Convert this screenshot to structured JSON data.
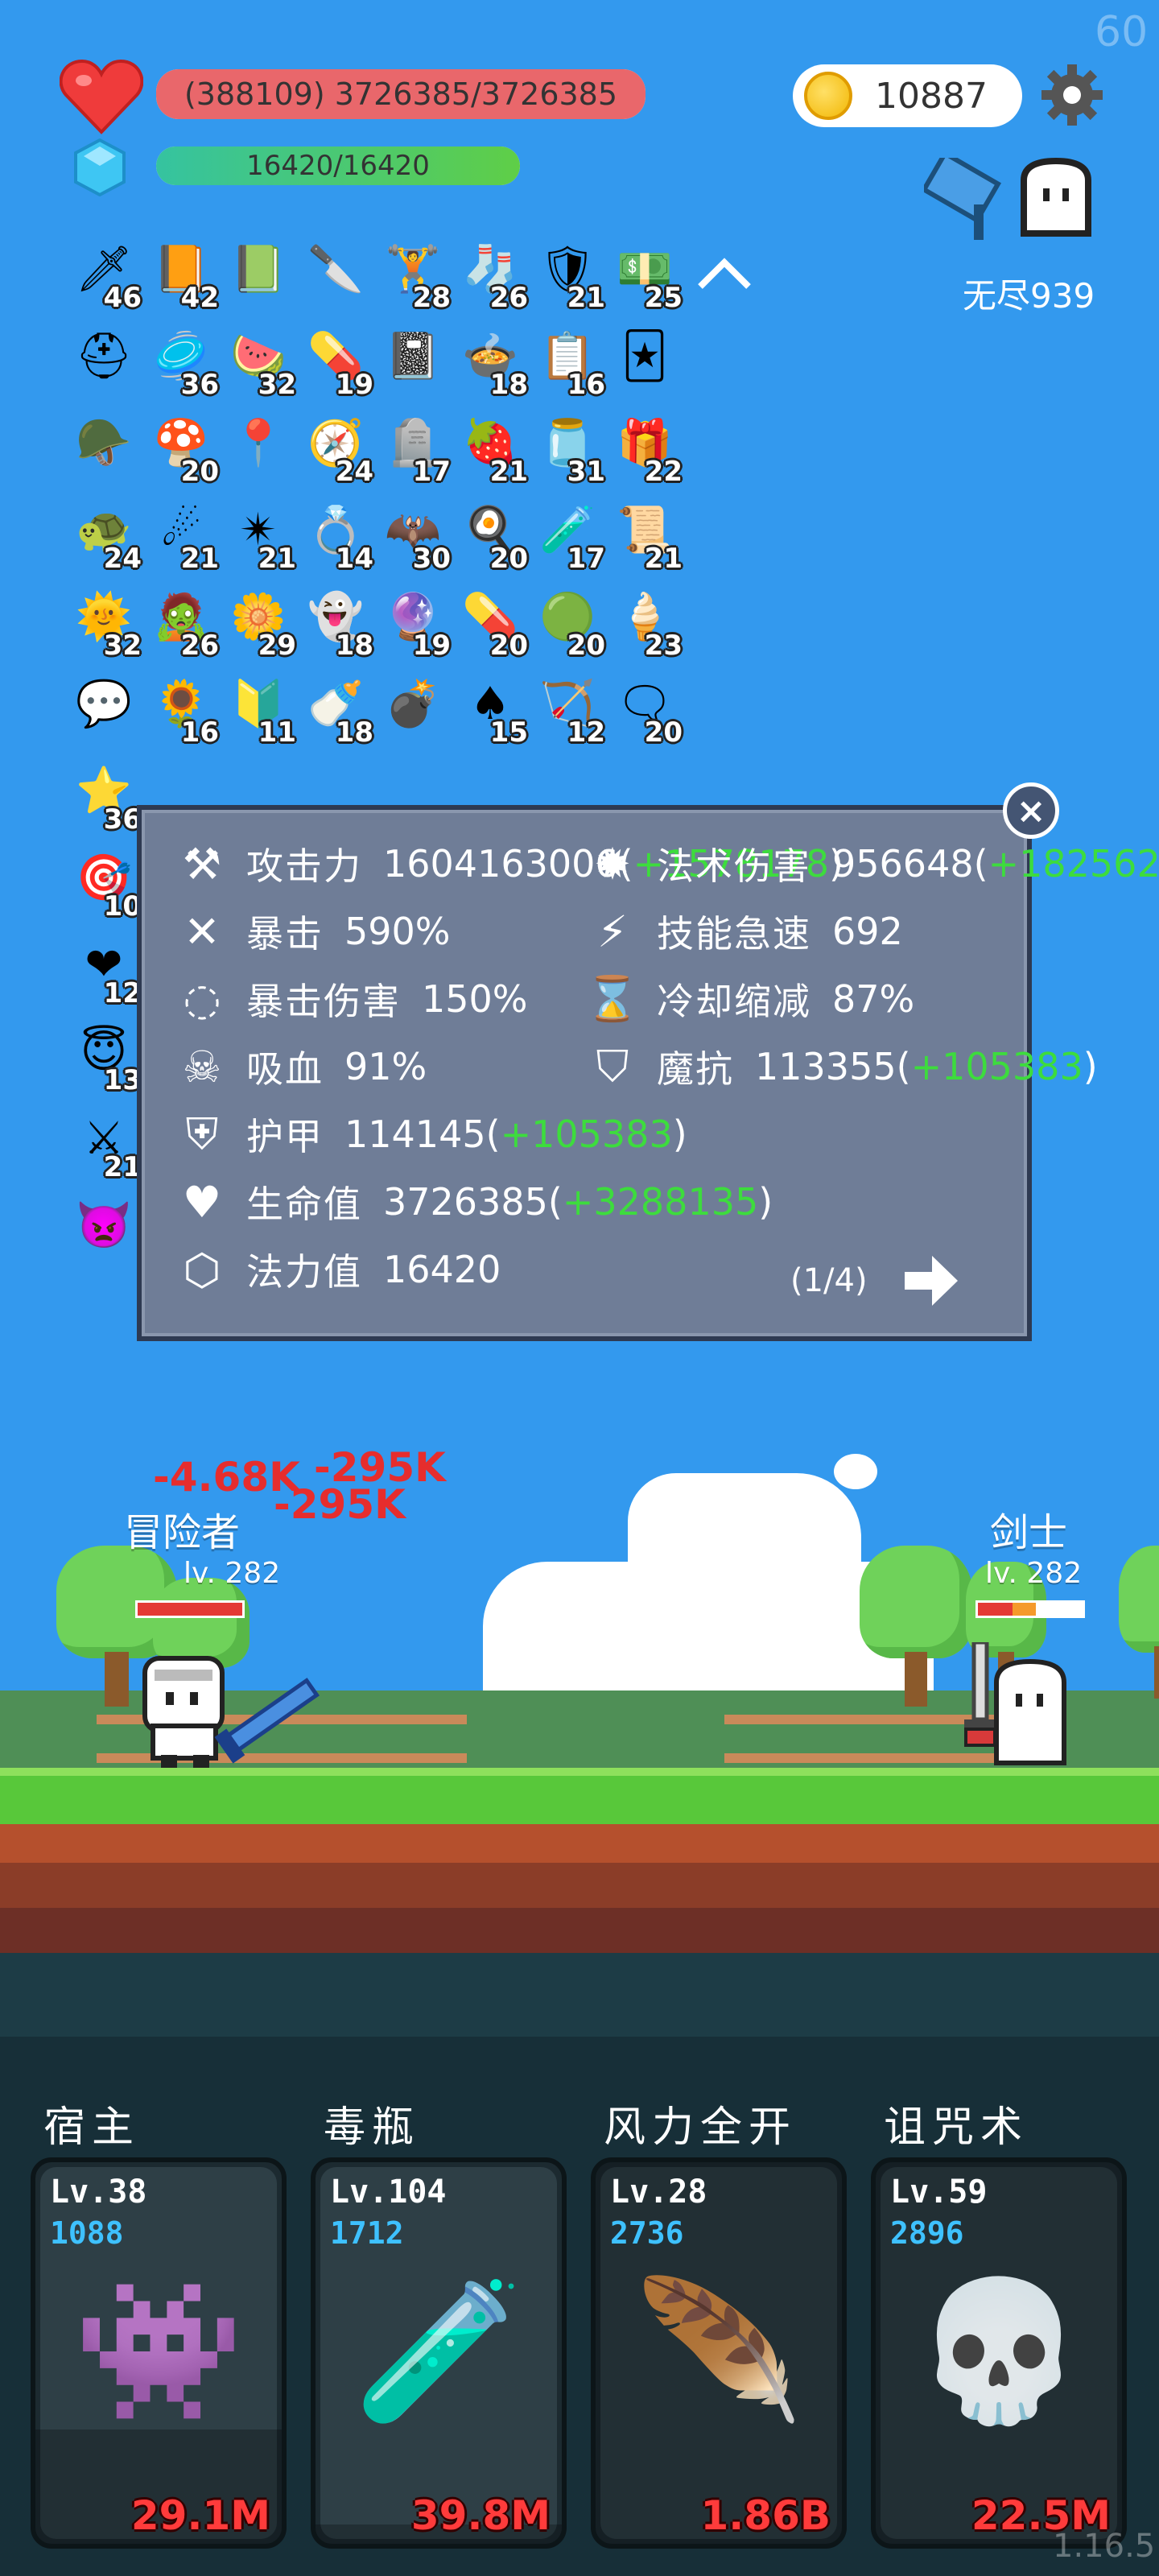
{
  "fps": "60",
  "version": "1.16.5",
  "hud": {
    "hp_text": "(388109) 3726385/3726385",
    "hp_fraction": 1.0,
    "mp_text": "16420/16420",
    "mp_fraction": 1.0,
    "coins": "10887",
    "mode_label": "无尽939"
  },
  "inventory": [
    {
      "icon": "sword-icon",
      "glyph": "🗡",
      "count": "46"
    },
    {
      "icon": "book-icon",
      "glyph": "📙",
      "count": "42"
    },
    {
      "icon": "note-icon",
      "glyph": "📗",
      "count": ""
    },
    {
      "icon": "blade-icon",
      "glyph": "🔪",
      "count": ""
    },
    {
      "icon": "dumbbell-icon",
      "glyph": "🏋",
      "count": "28"
    },
    {
      "icon": "sock-icon",
      "glyph": "🧦",
      "count": "26"
    },
    {
      "icon": "shield-icon",
      "glyph": "🛡",
      "count": "21"
    },
    {
      "icon": "money-heart-icon",
      "glyph": "💵",
      "count": "25"
    },
    {
      "icon": "helmet-icon",
      "glyph": "⛑",
      "count": ""
    },
    {
      "icon": "round-shield-icon",
      "glyph": "🥏",
      "count": "36"
    },
    {
      "icon": "watermelon-icon",
      "glyph": "🍉",
      "count": "32"
    },
    {
      "icon": "pill-icon",
      "glyph": "💊",
      "count": "19"
    },
    {
      "icon": "skull-book-icon",
      "glyph": "📓",
      "count": ""
    },
    {
      "icon": "cauldron-icon",
      "glyph": "🍲",
      "count": "18"
    },
    {
      "icon": "clipboard-icon",
      "glyph": "📋",
      "count": "16"
    },
    {
      "icon": "cards-icon",
      "glyph": "🃏",
      "count": ""
    },
    {
      "icon": "knight-helmet-icon",
      "glyph": "🪖",
      "count": ""
    },
    {
      "icon": "mushroom-icon",
      "glyph": "🍄",
      "count": "20"
    },
    {
      "icon": "map-pin-icon",
      "glyph": "📍",
      "count": ""
    },
    {
      "icon": "compass-icon",
      "glyph": "🧭",
      "count": "24"
    },
    {
      "icon": "tombstone-icon",
      "glyph": "🪦",
      "count": "17"
    },
    {
      "icon": "strawberry-icon",
      "glyph": "🍓",
      "count": "21"
    },
    {
      "icon": "jam-jar-icon",
      "glyph": "🫙",
      "count": "31"
    },
    {
      "icon": "purple-box-icon",
      "glyph": "🎁",
      "count": "22"
    },
    {
      "icon": "turtle-shell-icon",
      "glyph": "🐢",
      "count": "24"
    },
    {
      "icon": "meteor-icon",
      "glyph": "☄",
      "count": "21"
    },
    {
      "icon": "spike-ball-icon",
      "glyph": "✴",
      "count": "21"
    },
    {
      "icon": "ring-icon",
      "glyph": "💍",
      "count": "14"
    },
    {
      "icon": "bat-icon",
      "glyph": "🦇",
      "count": "30"
    },
    {
      "icon": "egg-icon",
      "glyph": "🍳",
      "count": "20"
    },
    {
      "icon": "potion-flask-icon",
      "glyph": "🧪",
      "count": "17"
    },
    {
      "icon": "scroll-icon",
      "glyph": "📜",
      "count": "21"
    },
    {
      "icon": "sun-icon",
      "glyph": "🌞",
      "count": "32"
    },
    {
      "icon": "zombie-icon",
      "glyph": "🧟",
      "count": "26"
    },
    {
      "icon": "flower-icon",
      "glyph": "🌼",
      "count": "29"
    },
    {
      "icon": "ghost-icon",
      "glyph": "👻",
      "count": "18"
    },
    {
      "icon": "crystal-ball-icon",
      "glyph": "🔮",
      "count": "19"
    },
    {
      "icon": "red-pill-icon",
      "glyph": "💊",
      "count": "20"
    },
    {
      "icon": "slime-icon",
      "glyph": "🟢",
      "count": "20"
    },
    {
      "icon": "ice-cream-icon",
      "glyph": "🍦",
      "count": "23"
    },
    {
      "icon": "chat-bubble-icon",
      "glyph": "💬",
      "count": ""
    },
    {
      "icon": "sunflower-icon",
      "glyph": "🌻",
      "count": "16"
    },
    {
      "icon": "star-shield-icon",
      "glyph": "🔰",
      "count": "11"
    },
    {
      "icon": "milk-bottle-icon",
      "glyph": "🍼",
      "count": "18"
    },
    {
      "icon": "grenade-icon",
      "glyph": "💣",
      "count": ""
    },
    {
      "icon": "playing-card-icon",
      "glyph": "♠",
      "count": "15"
    },
    {
      "icon": "crossbow-icon",
      "glyph": "🏹",
      "count": "12"
    },
    {
      "icon": "speech-icon",
      "glyph": "🗨",
      "count": "20"
    },
    {
      "icon": "star-card-icon",
      "glyph": "⭐",
      "count": "36"
    },
    {
      "icon": "target-icon",
      "glyph": "🎯",
      "count": "10"
    },
    {
      "icon": "heart-item-icon",
      "glyph": "❤",
      "count": "12"
    },
    {
      "icon": "angel-wings-icon",
      "glyph": "😇",
      "count": "13"
    },
    {
      "icon": "pixel-sword-icon",
      "glyph": "⚔",
      "count": "21"
    },
    {
      "icon": "demon-face-icon",
      "glyph": "👿",
      "count": ""
    }
  ],
  "stats_panel": {
    "page": "(1/4)",
    "rows": [
      {
        "icon": "axe-icon",
        "glyph": "⚒",
        "label": "攻击力",
        "value": "1604163006",
        "bonus": "+1578178"
      },
      {
        "icon": "magic-sun-icon",
        "glyph": "✹",
        "label": "法术伤害",
        "value": "956648",
        "bonus": "+182562"
      },
      {
        "icon": "crit-icon",
        "glyph": "✕",
        "label": "暴击",
        "value": "590%",
        "bonus": ""
      },
      {
        "icon": "lightning-icon",
        "glyph": "⚡",
        "label": "技能急速",
        "value": "692",
        "bonus": ""
      },
      {
        "icon": "crit-damage-icon",
        "glyph": "◌",
        "label": "暴击伤害",
        "value": "150%",
        "bonus": ""
      },
      {
        "icon": "hourglass-icon",
        "glyph": "⌛",
        "label": "冷却缩减",
        "value": "87%",
        "bonus": ""
      },
      {
        "icon": "vampire-skull-icon",
        "glyph": "☠",
        "label": "吸血",
        "value": "91%",
        "bonus": ""
      },
      {
        "icon": "magic-resist-icon",
        "glyph": "⛉",
        "label": "魔抗",
        "value": "113355",
        "bonus": "+105383"
      },
      {
        "icon": "armor-icon",
        "glyph": "⛨",
        "label": "护甲",
        "value": "114145",
        "bonus": "+105383"
      },
      {
        "icon": "heart-stat-icon",
        "glyph": "♥",
        "label": "生命值",
        "value": "3726385",
        "bonus": "+3288135"
      },
      {
        "icon": "mana-crystal-icon",
        "glyph": "⬡",
        "label": "法力值",
        "value": "16420",
        "bonus": ""
      }
    ]
  },
  "battle": {
    "player_name": "冒险者",
    "player_level": "lv. 282",
    "player_hp_fraction": 1.0,
    "enemy_name": "剑士",
    "enemy_level": "lv. 282",
    "enemy_hp_fraction": 0.55,
    "damage_numbers": [
      "-4.68K",
      "-295K",
      "-295K"
    ]
  },
  "skills": [
    {
      "title": "宿主",
      "level": "Lv.38",
      "value": "1088",
      "dps": "29.1M",
      "icon": "monster-icon",
      "glyph": "👾",
      "ready": 0.3
    },
    {
      "title": "毒瓶",
      "level": "Lv.104",
      "value": "1712",
      "dps": "39.8M",
      "icon": "poison-bottle-icon",
      "glyph": "🧪",
      "ready": 0.05
    },
    {
      "title": "风力全开",
      "level": "Lv.28",
      "value": "2736",
      "dps": "1.86B",
      "icon": "feather-icon",
      "glyph": "🪶",
      "ready": 1.0
    },
    {
      "title": "诅咒术",
      "level": "Lv.59",
      "value": "2896",
      "dps": "22.5M",
      "icon": "skull-icon",
      "glyph": "💀",
      "ready": 1.0
    }
  ]
}
